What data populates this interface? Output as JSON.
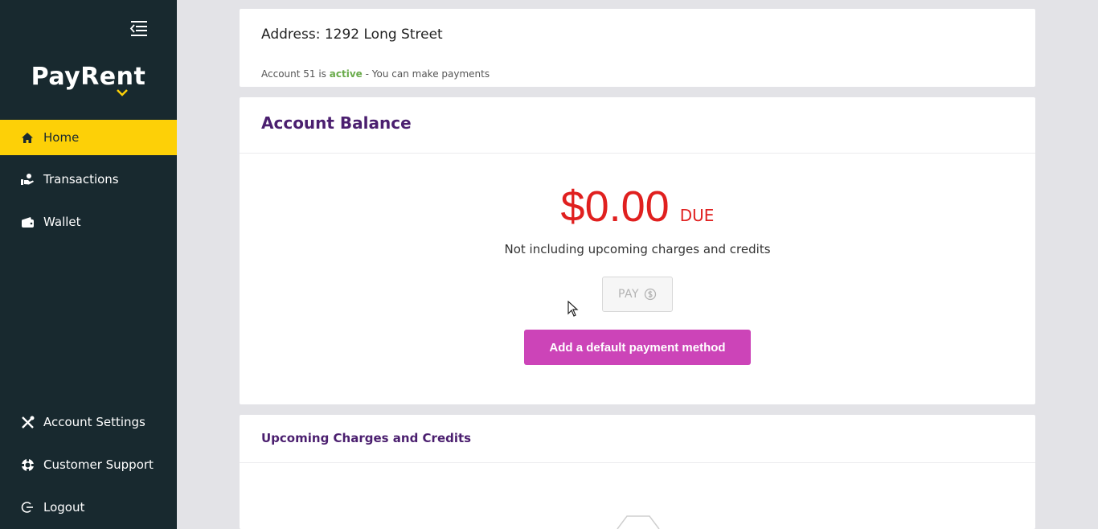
{
  "sidebar": {
    "logo": "PayRent",
    "items": [
      {
        "label": "Home",
        "icon": "home-icon",
        "active": true
      },
      {
        "label": "Transactions",
        "icon": "transactions-icon",
        "active": false
      },
      {
        "label": "Wallet",
        "icon": "wallet-icon",
        "active": false
      }
    ],
    "bottom_items": [
      {
        "label": "Account Settings",
        "icon": "tools-icon"
      },
      {
        "label": "Customer Support",
        "icon": "support-icon"
      },
      {
        "label": "Logout",
        "icon": "logout-icon"
      }
    ]
  },
  "address_card": {
    "title": "Address: 1292 Long Street",
    "status_prefix": "Account 51 is",
    "status_word": "active",
    "status_suffix": "- You can make payments"
  },
  "balance_card": {
    "title": "Account Balance",
    "amount": "$0.00",
    "due_label": "DUE",
    "note": "Not including upcoming charges and credits",
    "pay_label": "PAY",
    "add_payment_label": "Add a default payment method"
  },
  "upcoming_card": {
    "title": "Upcoming Charges and Credits"
  },
  "colors": {
    "sidebar_bg": "#18292f",
    "active_nav": "#fdd007",
    "title_purple": "#4b1f6f",
    "amount_red": "#e0201f",
    "cta_magenta": "#cc44b8",
    "active_green": "#6aab4b"
  }
}
